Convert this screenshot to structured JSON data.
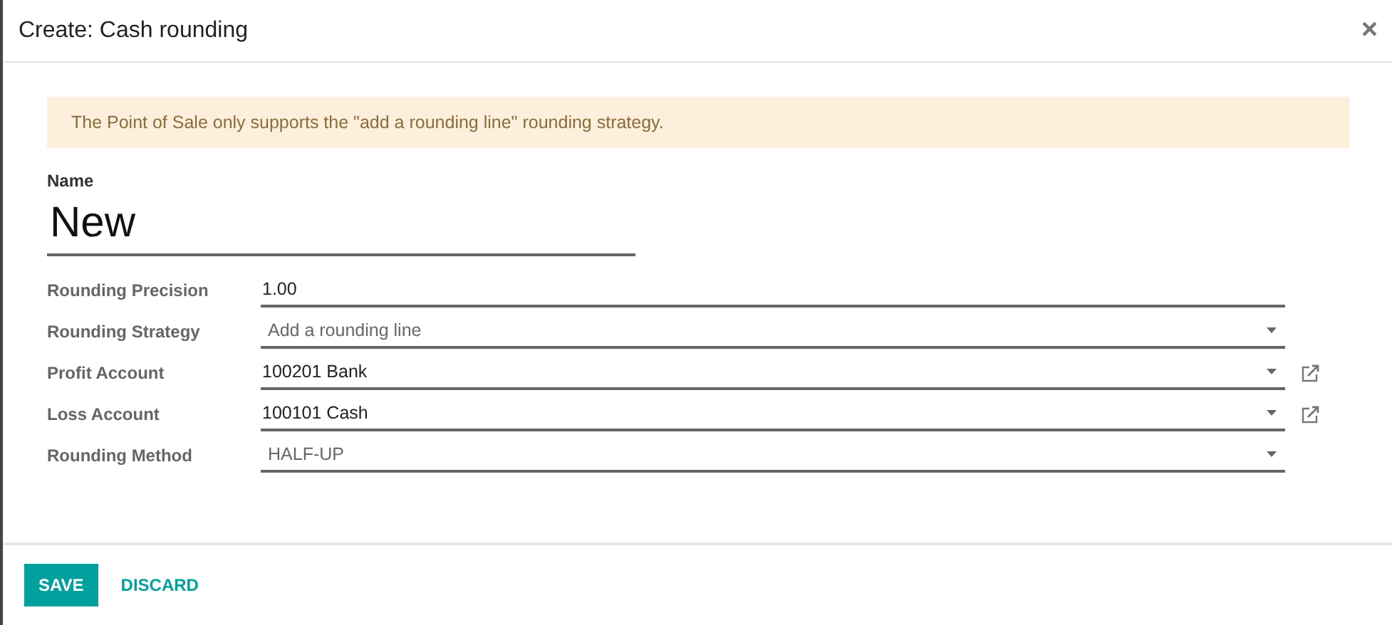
{
  "dialog": {
    "title": "Create: Cash rounding",
    "close": "×"
  },
  "alert": "The Point of Sale only supports the \"add a rounding line\" rounding strategy.",
  "name_field": {
    "label": "Name",
    "value": "New"
  },
  "fields": [
    {
      "label": "Rounding Precision",
      "value": "1.00",
      "kind": "text",
      "external_link": false
    },
    {
      "label": "Rounding Strategy",
      "value": "Add a rounding line",
      "kind": "select",
      "external_link": false
    },
    {
      "label": "Profit Account",
      "value": "100201 Bank",
      "kind": "many2one",
      "external_link": true
    },
    {
      "label": "Loss Account",
      "value": "100101 Cash",
      "kind": "many2one",
      "external_link": true
    },
    {
      "label": "Rounding Method",
      "value": "HALF-UP",
      "kind": "select",
      "external_link": false
    }
  ],
  "buttons": [
    {
      "label": "SAVE",
      "kind": "primary"
    },
    {
      "label": "DISCARD",
      "kind": "link"
    }
  ]
}
